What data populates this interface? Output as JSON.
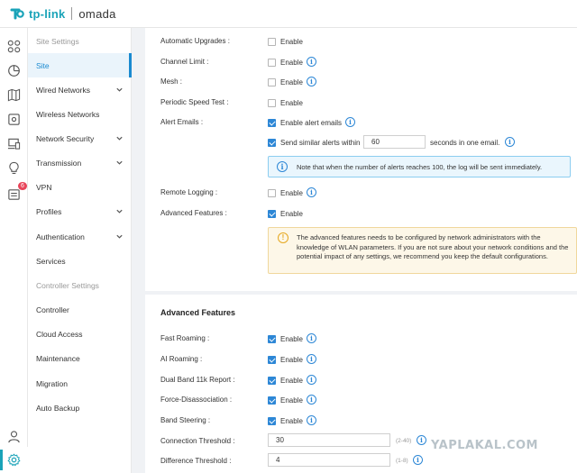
{
  "brand": {
    "tplink": "tp-link",
    "omada": "omada",
    "accent": "#1aa3b8"
  },
  "rail": {
    "icons": [
      "dashboard-icon",
      "statistics-icon",
      "map-icon",
      "devices-icon",
      "clients-icon",
      "insight-icon",
      "logs-icon",
      "account-icon",
      "settings-icon"
    ],
    "badge": "6"
  },
  "menu": {
    "site_settings": "Site Settings",
    "site": "Site",
    "wired_networks": "Wired Networks",
    "wireless_networks": "Wireless Networks",
    "network_security": "Network Security",
    "transmission": "Transmission",
    "vpn": "VPN",
    "profiles": "Profiles",
    "authentication": "Authentication",
    "services": "Services",
    "controller_settings": "Controller Settings",
    "controller": "Controller",
    "cloud_access": "Cloud Access",
    "maintenance": "Maintenance",
    "migration": "Migration",
    "auto_backup": "Auto Backup"
  },
  "settings": {
    "automatic_upgrades": {
      "label": "Automatic Upgrades :",
      "option": "Enable",
      "checked": false
    },
    "channel_limit": {
      "label": "Channel Limit :",
      "option": "Enable",
      "checked": false
    },
    "mesh": {
      "label": "Mesh :",
      "option": "Enable",
      "checked": false
    },
    "periodic_speed_test": {
      "label": "Periodic Speed Test :",
      "option": "Enable",
      "checked": false
    },
    "alert_emails": {
      "label": "Alert Emails :",
      "option": "Enable alert emails",
      "checked": true
    },
    "similar_alerts": {
      "prefix": "Send similar alerts within",
      "value": "60",
      "suffix": "seconds in one email.",
      "checked": true
    },
    "alert_note": "Note that when the number of alerts reaches 100, the log will be sent immediately.",
    "remote_logging": {
      "label": "Remote Logging :",
      "option": "Enable",
      "checked": false
    },
    "advanced_features": {
      "label": "Advanced Features :",
      "option": "Enable",
      "checked": true
    },
    "advanced_warning": "The advanced features needs to be configured by network administrators with the knowledge of WLAN parameters. If you are not sure about your network conditions and the potential impact of any settings, we recommend you keep the default configurations."
  },
  "advanced": {
    "title": "Advanced Features",
    "fast_roaming": {
      "label": "Fast Roaming :",
      "option": "Enable",
      "checked": true
    },
    "ai_roaming": {
      "label": "AI Roaming :",
      "option": "Enable",
      "checked": true
    },
    "dual_band_11k": {
      "label": "Dual Band 11k Report :",
      "option": "Enable",
      "checked": true
    },
    "force_disassociation": {
      "label": "Force-Disassociation :",
      "option": "Enable",
      "checked": true
    },
    "band_steering": {
      "label": "Band Steering :",
      "option": "Enable",
      "checked": true
    },
    "connection_threshold": {
      "label": "Connection Threshold :",
      "value": "30",
      "range": "(2-40)"
    },
    "difference_threshold": {
      "label": "Difference Threshold :",
      "value": "4",
      "range": "(1-8)"
    }
  },
  "watermark": "YAPLAKAL.COM"
}
